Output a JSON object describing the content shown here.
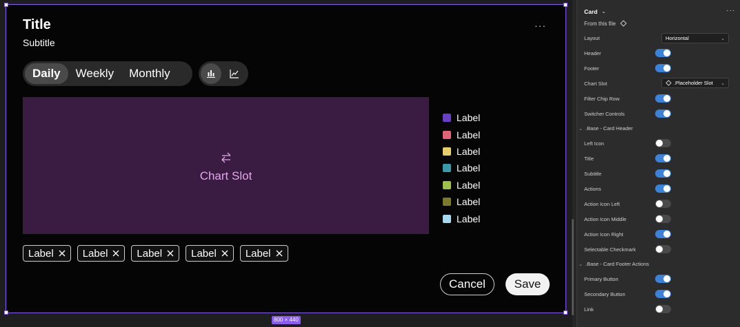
{
  "card": {
    "title": "Title",
    "subtitle": "Subtitle",
    "more_label": "···",
    "segments": [
      "Daily",
      "Weekly",
      "Monthly"
    ],
    "active_segment": "Daily",
    "chart_switch": [
      "bar-chart-icon",
      "line-chart-icon"
    ],
    "chart_slot_label": "Chart Slot",
    "legend": [
      {
        "label": "Label",
        "color": "#6a3fc8"
      },
      {
        "label": "Label",
        "color": "#e06376"
      },
      {
        "label": "Label",
        "color": "#e6cf6b"
      },
      {
        "label": "Label",
        "color": "#3a9aa8"
      },
      {
        "label": "Label",
        "color": "#9cc04a"
      },
      {
        "label": "Label",
        "color": "#7a7a2a"
      },
      {
        "label": "Label",
        "color": "#a6d8f2"
      }
    ],
    "chips": [
      "Label",
      "Label",
      "Label",
      "Label",
      "Label"
    ],
    "cancel_label": "Cancel",
    "save_label": "Save",
    "size_badge": "800 × 440"
  },
  "panel": {
    "component_name": "Card",
    "from_file": "From this file",
    "layout_label": "Layout",
    "layout_value": "Horizontal",
    "header": "Header",
    "footer": "Footer",
    "chart_slot_label": "Chart Slot",
    "chart_slot_value": ".Placeholder Slot",
    "filter_chip_row": "Filter Chip Row",
    "switcher_controls": "Switcher Controls",
    "section_header": ".Base - Card Header",
    "left_icon": "Left Icon",
    "title": "Title",
    "subtitle": "Subtitle",
    "actions": "Actions",
    "action_icon_left": "Action Icon Left",
    "action_icon_middle": "Action Icon Middle",
    "action_icon_right": "Action Icon Right",
    "selectable_checkmark": "Selectable Checkmark",
    "section_footer": ".Base - Card Footer Actions",
    "primary_button": "Primary Button",
    "secondary_button": "Secondary Button",
    "link": "Link",
    "toggles": {
      "header": true,
      "footer": true,
      "filter_chip_row": true,
      "switcher_controls": true,
      "left_icon": false,
      "title": true,
      "subtitle": true,
      "actions": true,
      "action_icon_left": false,
      "action_icon_middle": false,
      "action_icon_right": true,
      "selectable_checkmark": false,
      "primary_button": true,
      "secondary_button": true,
      "link": false
    },
    "accent": "#3b82d8",
    "selection_color": "#8a5cf6"
  }
}
